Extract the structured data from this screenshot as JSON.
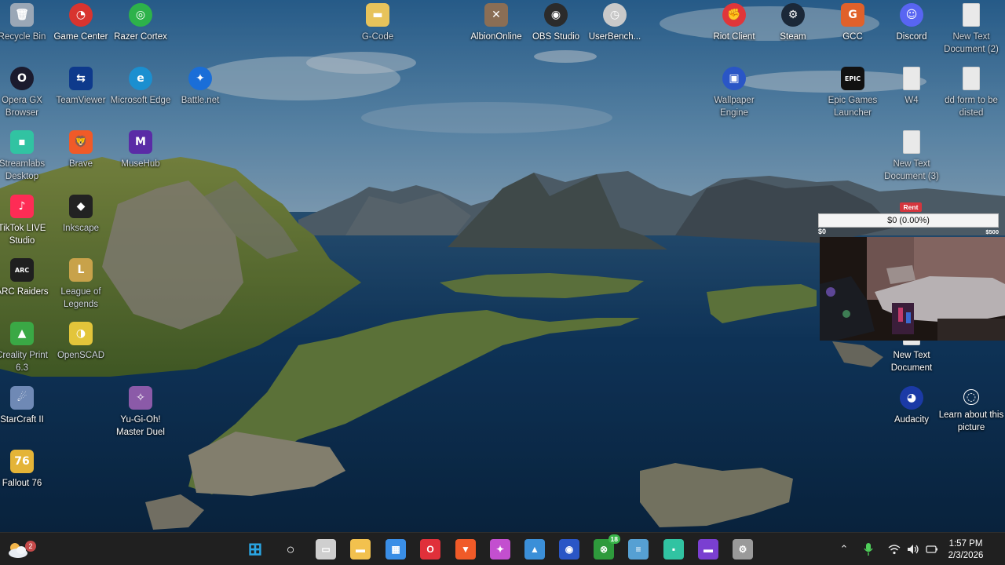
{
  "desktop": {
    "icons": [
      {
        "id": "recycle-bin",
        "label": "Recycle Bin",
        "icon": "recycle-bin-icon",
        "color": "#9aa7b6",
        "glyph": "🗑",
        "dim": true
      },
      {
        "id": "game-center",
        "label": "Game Center",
        "icon": "game-center-icon",
        "color": "#d8342f",
        "glyph": "◔"
      },
      {
        "id": "razer-cortex",
        "label": "Razer Cortex",
        "icon": "razer-cortex-icon",
        "color": "#2db24a",
        "glyph": "◎"
      },
      {
        "id": "g-code",
        "label": "G-Code",
        "icon": "folder-icon",
        "color": "#e7c35b",
        "glyph": "▬",
        "dim": true
      },
      {
        "id": "albion-online",
        "label": "AlbionOnline",
        "icon": "albion-online-icon",
        "color": "#8a6e55",
        "glyph": "✕"
      },
      {
        "id": "obs-studio",
        "label": "OBS Studio",
        "icon": "obs-studio-icon",
        "color": "#2b2b2b",
        "glyph": "◉"
      },
      {
        "id": "userbench",
        "label": "UserBench...",
        "icon": "speedometer-icon",
        "color": "#c9c9c9",
        "glyph": "◷"
      },
      {
        "id": "riot-client",
        "label": "Riot Client",
        "icon": "riot-client-icon",
        "color": "#e0363a",
        "glyph": "✊"
      },
      {
        "id": "steam",
        "label": "Steam",
        "icon": "steam-icon",
        "color": "#1b2838",
        "glyph": "⚙"
      },
      {
        "id": "gcc",
        "label": "GCC",
        "icon": "gcc-icon",
        "color": "#e0612b",
        "glyph": "G"
      },
      {
        "id": "discord",
        "label": "Discord",
        "icon": "discord-icon",
        "color": "#5865f2",
        "glyph": "☺"
      },
      {
        "id": "new-text-2",
        "label": "New Text Document (2)",
        "icon": "text-file-icon",
        "color": "#e9e9e9",
        "glyph": "",
        "dim": true
      },
      {
        "id": "opera-gx",
        "label": "Opera GX Browser",
        "icon": "opera-gx-icon",
        "color": "#1b1b2e",
        "glyph": "O",
        "dim": true
      },
      {
        "id": "teamviewer",
        "label": "TeamViewer",
        "icon": "teamviewer-icon",
        "color": "#0e3a8c",
        "glyph": "⇆",
        "dim": true
      },
      {
        "id": "edge",
        "label": "Microsoft Edge",
        "icon": "edge-icon",
        "color": "#1b8fd0",
        "glyph": "e",
        "dim": true
      },
      {
        "id": "battlenet",
        "label": "Battle.net",
        "icon": "battlenet-icon",
        "color": "#1a6ed8",
        "glyph": "✦",
        "dim": true
      },
      {
        "id": "wallpaper-engine",
        "label": "Wallpaper Engine",
        "icon": "wallpaper-engine-icon",
        "color": "#2a56c6",
        "glyph": "▣",
        "dim": true
      },
      {
        "id": "epic-games",
        "label": "Epic Games Launcher",
        "icon": "epic-games-icon",
        "color": "#111111",
        "glyph": "EPIC",
        "dim": true
      },
      {
        "id": "w4",
        "label": "W4",
        "icon": "document-icon",
        "color": "#e9e9e9",
        "glyph": "",
        "dim": true
      },
      {
        "id": "dd-form",
        "label": "dd form to be disted",
        "icon": "text-file-icon",
        "color": "#e9e9e9",
        "glyph": "",
        "dim": true
      },
      {
        "id": "streamlabs",
        "label": "Streamlabs Desktop",
        "icon": "streamlabs-icon",
        "color": "#31c3a2",
        "glyph": "▪",
        "dim": true
      },
      {
        "id": "brave",
        "label": "Brave",
        "icon": "brave-icon",
        "color": "#f05a28",
        "glyph": "🦁",
        "dim": true
      },
      {
        "id": "musehub",
        "label": "MuseHub",
        "icon": "musehub-icon",
        "color": "#5a2ba6",
        "glyph": "M",
        "dim": true
      },
      {
        "id": "new-text-3",
        "label": "New Text Document (3)",
        "icon": "text-file-icon",
        "color": "#e9e9e9",
        "glyph": "",
        "dim": true
      },
      {
        "id": "tiktok-live",
        "label": "TikTok LIVE Studio",
        "icon": "tiktok-live-icon",
        "color": "#fe2c55",
        "glyph": "♪"
      },
      {
        "id": "inkscape",
        "label": "Inkscape",
        "icon": "inkscape-icon",
        "color": "#222222",
        "glyph": "◆",
        "dim": true
      },
      {
        "id": "arc-raiders",
        "label": "ARC Raiders",
        "icon": "arc-raiders-icon",
        "color": "#1f1f1f",
        "glyph": "ARC"
      },
      {
        "id": "league",
        "label": "League of Legends",
        "icon": "league-of-legends-icon",
        "color": "#c8a24a",
        "glyph": "L",
        "dim": true
      },
      {
        "id": "creality",
        "label": "Creality Print 6.3",
        "icon": "creality-print-icon",
        "color": "#3aa845",
        "glyph": "▲",
        "dim": true
      },
      {
        "id": "openscad",
        "label": "OpenSCAD",
        "icon": "openscad-icon",
        "color": "#e3c53a",
        "glyph": "◑",
        "dim": true
      },
      {
        "id": "new-text",
        "label": "New Text Document",
        "icon": "text-file-icon",
        "color": "#e9e9e9",
        "glyph": ""
      },
      {
        "id": "starcraft",
        "label": "StarCraft II",
        "icon": "starcraft-icon",
        "color": "#6f89b5",
        "glyph": "☄"
      },
      {
        "id": "yugioh",
        "label": "Yu-Gi-Oh! Master Duel",
        "icon": "yugioh-icon",
        "color": "#8b5aa8",
        "glyph": "✧"
      },
      {
        "id": "audacity",
        "label": "Audacity",
        "icon": "audacity-icon",
        "color": "#1b3aa6",
        "glyph": "◕"
      },
      {
        "id": "learn-picture",
        "label": "Learn about this picture",
        "icon": "camera-info-icon",
        "color": "rgba(0,0,0,0)",
        "glyph": "◌"
      },
      {
        "id": "fallout",
        "label": "Fallout 76",
        "icon": "fallout-icon",
        "color": "#e4b437",
        "glyph": "76"
      }
    ]
  },
  "overlay": {
    "title": "Rent",
    "progress_text": "$0 (0.00%)",
    "progress_fraction": 0.0,
    "min_label": "$0",
    "max_label": "$500"
  },
  "taskbar": {
    "weather_badge": "2",
    "xbox_badge": "18",
    "apps": [
      {
        "id": "start",
        "icon": "windows-start-icon",
        "color": "#2aa7e6"
      },
      {
        "id": "search",
        "icon": "search-icon",
        "color": "#ffffff"
      },
      {
        "id": "task-view",
        "icon": "task-view-icon",
        "color": "#cfcfcf"
      },
      {
        "id": "file-explorer",
        "icon": "folder-icon",
        "color": "#f2c14e"
      },
      {
        "id": "store",
        "icon": "store-icon",
        "color": "#3a8ee6"
      },
      {
        "id": "opera-gx",
        "icon": "opera-gx-icon",
        "color": "#e0303a"
      },
      {
        "id": "brave",
        "icon": "brave-icon",
        "color": "#f05a28"
      },
      {
        "id": "copilot",
        "icon": "copilot-icon",
        "color": "#c34fcf"
      },
      {
        "id": "photos",
        "icon": "photos-icon",
        "color": "#3b8fd8"
      },
      {
        "id": "wallpaper-engine",
        "icon": "wallpaper-engine-icon",
        "color": "#2a56c6"
      },
      {
        "id": "xbox",
        "icon": "xbox-icon",
        "color": "#2e9a3c"
      },
      {
        "id": "notepad",
        "icon": "notepad-icon",
        "color": "#56a0d3"
      },
      {
        "id": "streamlabs",
        "icon": "streamlabs-icon",
        "color": "#31c3a2"
      },
      {
        "id": "clipchamp",
        "icon": "clipchamp-icon",
        "color": "#7a3fd1"
      },
      {
        "id": "settings",
        "icon": "gear-icon",
        "color": "#9a9a9a"
      }
    ],
    "clock": {
      "time": "1:57 PM",
      "date": "2/3/2026"
    }
  }
}
